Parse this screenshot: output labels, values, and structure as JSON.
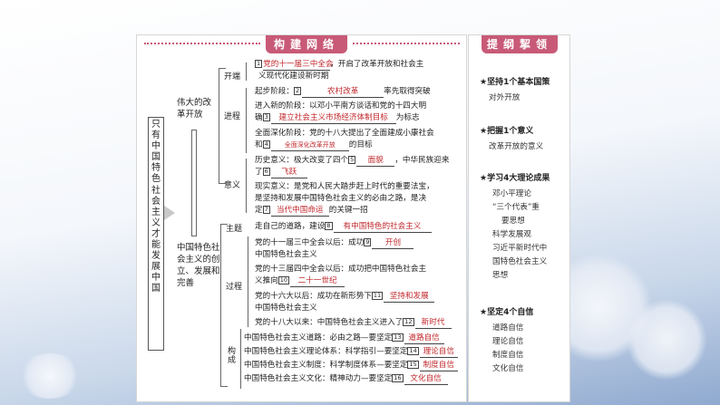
{
  "left_tab": "构建网络",
  "right_tab": "提纲挈领",
  "root_title": "只有中国特色社会主义才能发展中国",
  "branch_reform": "伟大的改革开放",
  "branch_socialism": "中国特色社会主义的创立、发展和完善",
  "labels": {
    "kaiduan": "开端",
    "jincheng": "进程",
    "yiyi": "意义",
    "zhuti": "主题",
    "guocheng": "过程",
    "goucheng": "构成"
  },
  "lines": {
    "l1_num": "1",
    "l1_ans": "党的十一届三中全会",
    "l1_a": "，开启了改革开放和社会主",
    "l1_b": "义现代化建设新时期",
    "l2_pre": "起步阶段：",
    "l2_num": "2",
    "l2_ans": "农村改革",
    "l2_post": "率先取得突破",
    "l3_a": "进入新的阶段：以邓小平南方谈话和党的十四大明",
    "l3_pre": "确",
    "l3_num": "3",
    "l3_ans": "建立社会主义市场经济体制目标",
    "l3_post": "为标志",
    "l4_a": "全面深化阶段：党的十八大提出了全面建成小康社会",
    "l4_pre": "和",
    "l4_num": "4",
    "l4_ans": "全面深化改革开放",
    "l4_post": "的目标",
    "l5_pre": "历史意义：极大改变了四个",
    "l5_num": "5",
    "l5_ans": "面貌",
    "l5_post": "，中华民族迎来",
    "l5b_pre": "了",
    "l5b_num": "6",
    "l5b_ans": "飞跃",
    "l6_a": "现实意义：是党和人民大踏步赶上时代的重要法宝，",
    "l6_b": "是坚持和发展中国特色社会主义的必由之路，是决",
    "l6_pre": "定",
    "l6_num": "7",
    "l6_ans": "当代中国命运",
    "l6_post": "的关键一招",
    "l7_pre": "走自己的道路，建设",
    "l7_num": "8",
    "l7_ans": "有中国特色的社会主义",
    "l8_pre": "党的十一届三中全会以后：成功",
    "l8_num": "9",
    "l8_ans": "开创",
    "l8_b": "中国特色社会主义",
    "l9_a": "党的十三届四中全会以后：成功把中国特色社会主",
    "l9_pre": "义推向",
    "l9_num": "10",
    "l9_ans": "二十一世纪",
    "l10_pre": "党的十六大以后：成功在新形势下",
    "l10_num": "11",
    "l10_ans": "坚持和发展",
    "l10_b": "中国特色社会主义",
    "l11_pre": "党的十八大以来：中国特色社会主义进入了",
    "l11_num": "12",
    "l11_ans": "新时代",
    "l12_pre": "中国特色社会主义道路：必由之路—要坚定",
    "l12_num": "13",
    "l12_ans": "道路自信",
    "l13_pre": "中国特色社会主义理论体系：科学指引—要坚定",
    "l13_num": "14",
    "l13_ans": "理论自信",
    "l14_pre": "中国特色社会主义制度：科学制度体系—要坚定",
    "l14_num": "15",
    "l14_ans": "制度自信",
    "l15_pre": "中国特色社会主义文化：精神动力—要坚定",
    "l15_num": "16",
    "l15_ans": "文化自信"
  },
  "tips": {
    "t1": "坚持1个基本国策",
    "t1_s": "对外开放",
    "t2": "把握1个意义",
    "t2_s": "改革开放的意义",
    "t3": "学习4大理论成果",
    "t3_s": [
      "邓小平理论",
      "“三个代表”重",
      "要思想",
      "科学发展观",
      "习近平新时代中",
      "国特色社会主义",
      "思想"
    ],
    "t4": "坚定4个自信",
    "t4_s": [
      "道路自信",
      "理论自信",
      "制度自信",
      "文化自信"
    ]
  },
  "colors": {
    "accent": "#c85a77",
    "answer": "#c0282c"
  }
}
